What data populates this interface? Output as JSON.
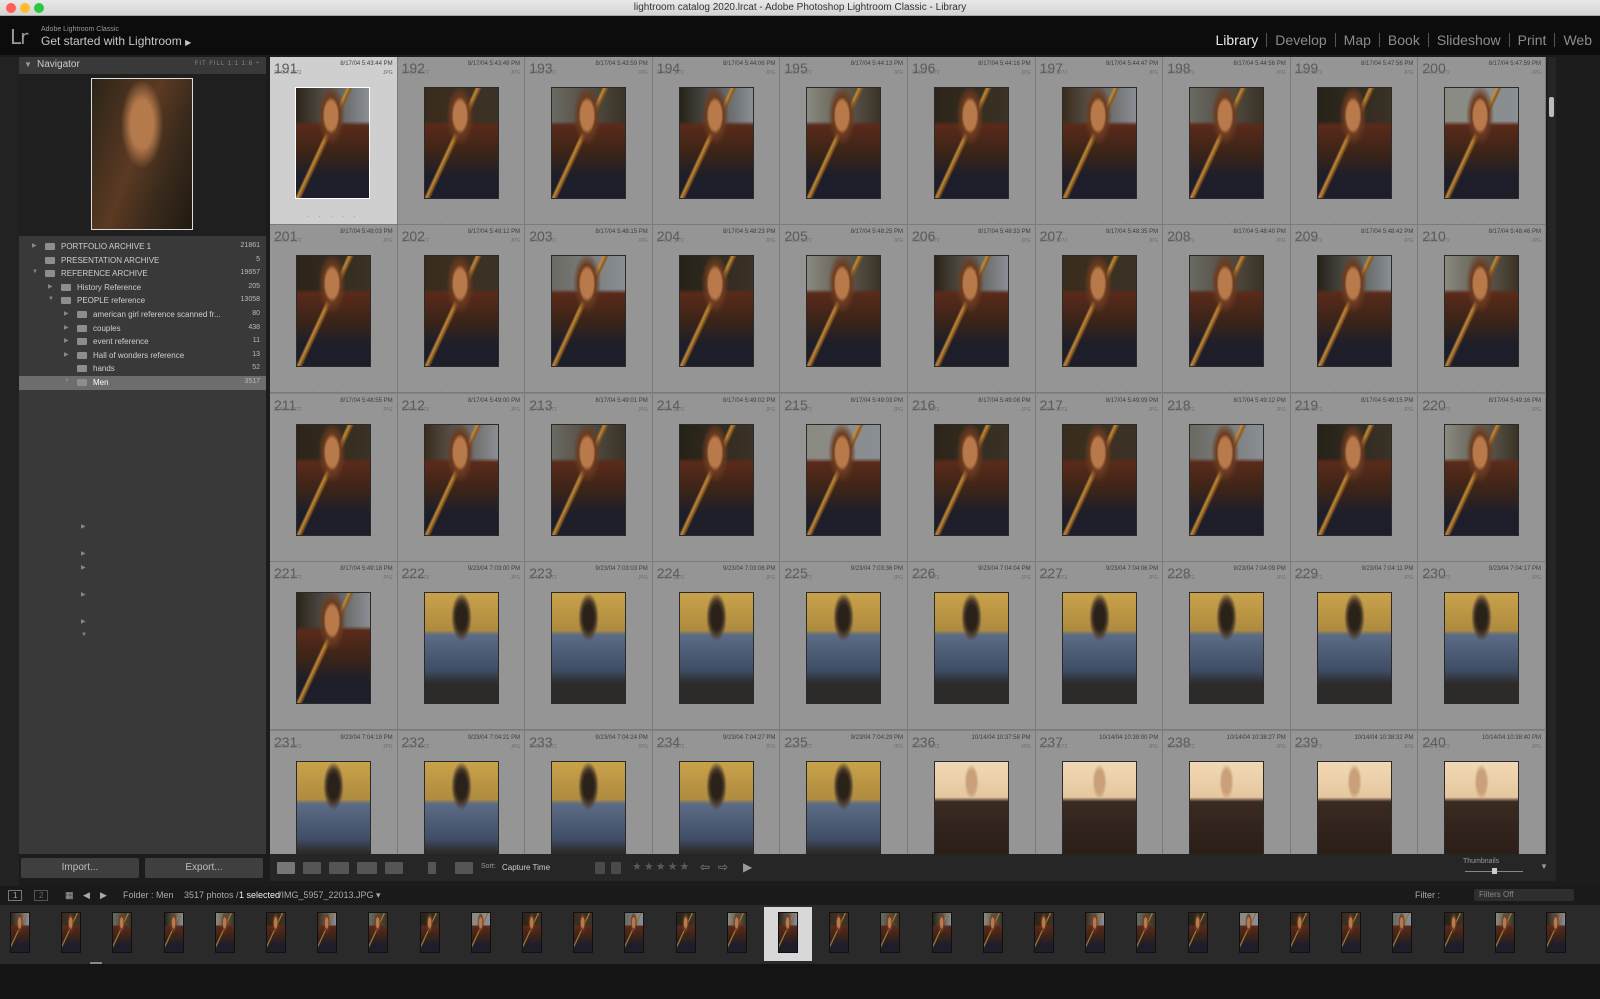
{
  "window": {
    "title": "lightroom catalog 2020.lrcat - Adobe Photoshop Lightroom Classic - Library"
  },
  "identity": {
    "app": "Adobe Lightroom Classic",
    "tagline": "Get started with Lightroom",
    "logo": "Lr"
  },
  "modules": [
    "Library",
    "Develop",
    "Map",
    "Book",
    "Slideshow",
    "Print",
    "Web"
  ],
  "navigator": {
    "title": "Navigator",
    "zoom": "FIT  FILL  1:1  1:8 ÷"
  },
  "folders": [
    {
      "name": "PORTFOLIO ARCHIVE 1",
      "count": "21861",
      "indent": 0,
      "open": false
    },
    {
      "name": "PRESENTATION ARCHIVE",
      "count": "5",
      "indent": 0,
      "open": null
    },
    {
      "name": "REFERENCE ARCHIVE",
      "count": "19657",
      "indent": 0,
      "open": true
    },
    {
      "name": "History Reference",
      "count": "205",
      "indent": 1,
      "open": false
    },
    {
      "name": "PEOPLE reference",
      "count": "13058",
      "indent": 1,
      "open": true
    },
    {
      "name": "american girl reference scanned fr...",
      "count": "80",
      "indent": 2,
      "open": false
    },
    {
      "name": "couples",
      "count": "438",
      "indent": 2,
      "open": false
    },
    {
      "name": "event reference",
      "count": "11",
      "indent": 2,
      "open": false
    },
    {
      "name": "Hall of wonders reference",
      "count": "13",
      "indent": 2,
      "open": false
    },
    {
      "name": "hands",
      "count": "52",
      "indent": 2,
      "open": null
    },
    {
      "name": "Men",
      "count": "3517",
      "indent": 2,
      "open": true,
      "selected": true
    }
  ],
  "left_buttons": {
    "import": "Import...",
    "export": "Export..."
  },
  "grid": {
    "dimensions": "2048 x 3072",
    "ext": "JPG",
    "rows": [
      {
        "nums": [
          "191",
          "192",
          "193",
          "194",
          "195",
          "196",
          "197",
          "198",
          "199",
          "200"
        ],
        "dates": [
          "8/17/04 5:43:44 PM",
          "8/17/04 5:43:49 PM",
          "8/17/04 5:43:59 PM",
          "8/17/04 5:44:06 PM",
          "8/17/04 5:44:13 PM",
          "8/17/04 5:44:16 PM",
          "8/17/04 5:44:47 PM",
          "8/17/04 5:44:56 PM",
          "8/17/04 5:47:56 PM",
          "8/17/04 5:47:59 PM"
        ]
      },
      {
        "nums": [
          "201",
          "202",
          "203",
          "204",
          "205",
          "206",
          "207",
          "208",
          "209",
          "210"
        ],
        "dates": [
          "8/17/04 5:48:03 PM",
          "8/17/04 5:48:12 PM",
          "8/17/04 5:48:15 PM",
          "8/17/04 5:48:23 PM",
          "8/17/04 5:48:25 PM",
          "8/17/04 5:48:33 PM",
          "8/17/04 5:48:35 PM",
          "8/17/04 5:48:40 PM",
          "8/17/04 5:48:42 PM",
          "8/17/04 5:48:46 PM"
        ]
      },
      {
        "nums": [
          "211",
          "212",
          "213",
          "214",
          "215",
          "216",
          "217",
          "218",
          "219",
          "220"
        ],
        "dates": [
          "8/17/04 5:48:55 PM",
          "8/17/04 5:49:00 PM",
          "8/17/04 5:49:01 PM",
          "8/17/04 5:49:02 PM",
          "8/17/04 5:49:03 PM",
          "8/17/04 5:49:08 PM",
          "8/17/04 5:49:09 PM",
          "8/17/04 5:49:12 PM",
          "8/17/04 5:49:15 PM",
          "8/17/04 5:49:16 PM"
        ]
      },
      {
        "nums": [
          "221",
          "222",
          "223",
          "224",
          "225",
          "226",
          "227",
          "228",
          "229",
          "230"
        ],
        "dates": [
          "8/17/04 5:49:18 PM",
          "9/23/04 7:03:00 PM",
          "9/23/04 7:03:03 PM",
          "9/23/04 7:03:06 PM",
          "9/23/04 7:03:36 PM",
          "9/23/04 7:04:04 PM",
          "9/23/04 7:04:06 PM",
          "9/23/04 7:04:09 PM",
          "9/23/04 7:04:11 PM",
          "9/23/04 7:04:17 PM"
        ]
      },
      {
        "nums": [
          "231",
          "232",
          "233",
          "234",
          "235",
          "236",
          "237",
          "238",
          "239",
          "240"
        ],
        "dates": [
          "9/23/04 7:04:19 PM",
          "9/23/04 7:04:21 PM",
          "9/23/04 7:04:24 PM",
          "9/23/04 7:04:27 PM",
          "9/23/04 7:04:29 PM",
          "10/14/04 10:37:58 PM",
          "10/14/04 10:38:00 PM",
          "10/14/04 10:38:27 PM",
          "10/14/04 10:38:32 PM",
          "10/14/04 10:38:40 PM"
        ]
      }
    ]
  },
  "toolbar": {
    "sort_label": "Sort:",
    "sort_value": "Capture Time",
    "thumbnails_label": "Thumbnails",
    "stars": "★★★★★"
  },
  "filmbar": {
    "screens": [
      "1",
      "2"
    ],
    "folder": "Folder : Men",
    "count": "3517 photos /",
    "selected": "1 selected",
    "file": "/IMG_5957_22013.JPG ▾",
    "filter_label": "Filter :",
    "filter_value": "Filters Off"
  },
  "colors": {
    "grid_bg": "#828282",
    "cell": "#959595",
    "selected_cell": "#cfcfcf",
    "panel": "#393939"
  }
}
